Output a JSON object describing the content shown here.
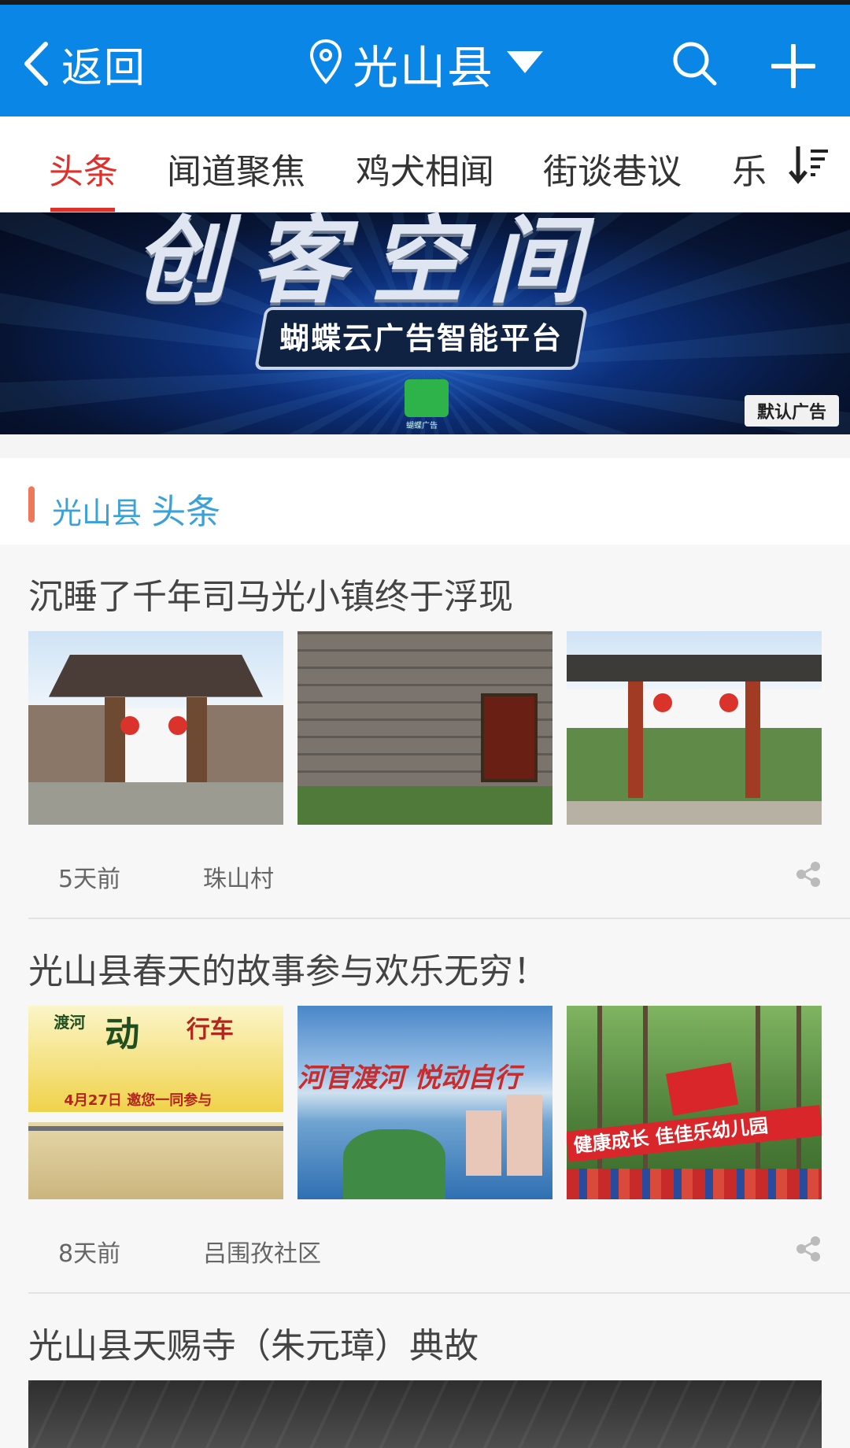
{
  "header": {
    "back_label": "返回",
    "location": "光山县"
  },
  "tabs": [
    {
      "label": "头条",
      "active": true
    },
    {
      "label": "闻道聚焦",
      "active": false
    },
    {
      "label": "鸡犬相闻",
      "active": false
    },
    {
      "label": "街谈巷议",
      "active": false
    },
    {
      "label": "乐",
      "active": false
    }
  ],
  "banner": {
    "headline": "创客空间",
    "platform": "蝴蝶云广告智能平台",
    "logo_caption": "蝴蝶广告",
    "ad_tag": "默认广告"
  },
  "section": {
    "county": "光山县",
    "title": "头条"
  },
  "articles": [
    {
      "title": "沉睡了千年司马光小镇终于浮现",
      "time": "5天前",
      "source": "珠山村"
    },
    {
      "title": "光山县春天的故事参与欢乐无穷！",
      "time": "8天前",
      "source": "吕围孜社区",
      "poster_text": "动",
      "poster_text2": "渡河",
      "poster_text3": "行车",
      "poster_date": "4月27日 邀您一同参与",
      "city_text": "河官渡河 悦动自行",
      "red_banner": "健康成长 佳佳乐幼儿园"
    },
    {
      "title": "光山县天赐寺（朱元璋）典故"
    }
  ],
  "colors": {
    "header_bg": "#0a86e6",
    "active_tab": "#e0302b",
    "section_bar": "#f0785a",
    "section_text": "#3aa2d8"
  }
}
